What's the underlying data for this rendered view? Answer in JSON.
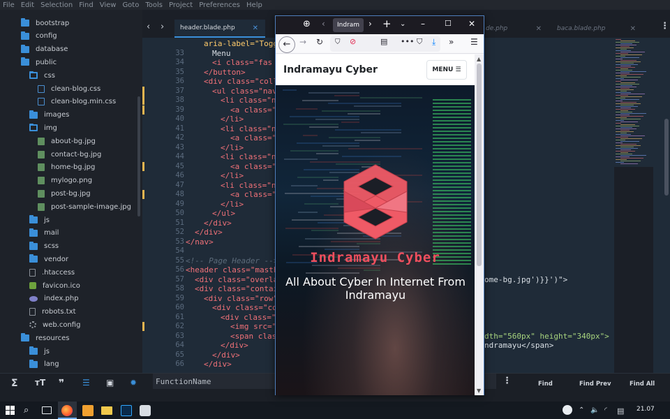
{
  "editor": {
    "menu": [
      "File",
      "Edit",
      "Selection",
      "Find",
      "View",
      "Goto",
      "Tools",
      "Project",
      "Preferences",
      "Help"
    ],
    "tree": [
      {
        "label": "bootstrap",
        "kind": "folder"
      },
      {
        "label": "config",
        "kind": "folder"
      },
      {
        "label": "database",
        "kind": "folder"
      },
      {
        "label": "public",
        "kind": "folder"
      },
      {
        "label": "css",
        "kind": "folder-open"
      },
      {
        "label": "clean-blog.css",
        "kind": "css"
      },
      {
        "label": "clean-blog.min.css",
        "kind": "css"
      },
      {
        "label": "images",
        "kind": "folder"
      },
      {
        "label": "img",
        "kind": "folder-open"
      },
      {
        "label": "about-bg.jpg",
        "kind": "image"
      },
      {
        "label": "contact-bg.jpg",
        "kind": "image"
      },
      {
        "label": "home-bg.jpg",
        "kind": "image"
      },
      {
        "label": "mylogo.png",
        "kind": "image"
      },
      {
        "label": "post-bg.jpg",
        "kind": "image"
      },
      {
        "label": "post-sample-image.jpg",
        "kind": "image"
      },
      {
        "label": "js",
        "kind": "folder"
      },
      {
        "label": "mail",
        "kind": "folder"
      },
      {
        "label": "scss",
        "kind": "folder"
      },
      {
        "label": "vendor",
        "kind": "folder"
      },
      {
        "label": ".htaccess",
        "kind": "file"
      },
      {
        "label": "favicon.ico",
        "kind": "favicon"
      },
      {
        "label": "index.php",
        "kind": "php"
      },
      {
        "label": "robots.txt",
        "kind": "file"
      },
      {
        "label": "web.config",
        "kind": "gear"
      },
      {
        "label": "resources",
        "kind": "folder"
      },
      {
        "label": "js",
        "kind": "folder"
      },
      {
        "label": "lang",
        "kind": "folder"
      }
    ],
    "tabs": [
      {
        "label": "header.blade.php",
        "active": true
      },
      {
        "label": "de.php",
        "active": false
      },
      {
        "label": "baca.blade.php",
        "active": false
      }
    ],
    "code_lines": [
      {
        "n": "",
        "text": "aria-label=\"Togg"
      },
      {
        "n": "33",
        "text": "Menu"
      },
      {
        "n": "34",
        "text": "<i class=\"fas f"
      },
      {
        "n": "35",
        "text": "</button>"
      },
      {
        "n": "36",
        "text": "<div class=\"colla"
      },
      {
        "n": "37",
        "text": "<ul class=\"navb"
      },
      {
        "n": "38",
        "text": "<li class=\"na"
      },
      {
        "n": "39",
        "text": "<a class=\"r"
      },
      {
        "n": "40",
        "text": "</li>"
      },
      {
        "n": "41",
        "text": "<li class=\"na"
      },
      {
        "n": "42",
        "text": "<a class=\"r"
      },
      {
        "n": "43",
        "text": "</li>"
      },
      {
        "n": "44",
        "text": "<li class=\"na"
      },
      {
        "n": "45",
        "text": "<a class=\"r"
      },
      {
        "n": "46",
        "text": "</li>"
      },
      {
        "n": "47",
        "text": "<li class=\"na"
      },
      {
        "n": "48",
        "text": "<a class=\"r"
      },
      {
        "n": "49",
        "text": "</li>"
      },
      {
        "n": "50",
        "text": "</ul>"
      },
      {
        "n": "51",
        "text": "</div>"
      },
      {
        "n": "52",
        "text": "</div>"
      },
      {
        "n": "53",
        "text": "</nav>"
      },
      {
        "n": "54",
        "text": ""
      },
      {
        "n": "55",
        "text": "<!-- Page Header -->"
      },
      {
        "n": "56",
        "text": "<header class=\"masthe"
      },
      {
        "n": "57",
        "text": "<div class=\"overla"
      },
      {
        "n": "58",
        "text": "<div class=\"contai"
      },
      {
        "n": "59",
        "text": "<div class=\"row\">"
      },
      {
        "n": "60",
        "text": "<div class=\"col"
      },
      {
        "n": "61",
        "text": "<div class=\"s"
      },
      {
        "n": "62",
        "text": "<img src=\"{"
      },
      {
        "n": "63",
        "text": "<span class"
      },
      {
        "n": "64",
        "text": "</div>"
      },
      {
        "n": "65",
        "text": "</div>"
      },
      {
        "n": "66",
        "text": "</div>"
      }
    ],
    "code_right": {
      "line56": "ome-bg.jpg')}}')\">",
      "line62": "dth=\"560px\" height=\"340px\">",
      "line63": "ndramayu</span>"
    },
    "find": {
      "value": "FunctionName",
      "find_label": "Find",
      "find_prev_label": "Find Prev",
      "find_all_label": "Find All"
    }
  },
  "browser": {
    "tab_title": "Indram",
    "site": {
      "brand": "Indramayu Cyber",
      "menu_label": "MENU",
      "hero_title": "Indramayu Cyber",
      "hero_subtitle": "All About Cyber In Internet From Indramayu"
    }
  },
  "taskbar": {
    "time": "21.07"
  }
}
